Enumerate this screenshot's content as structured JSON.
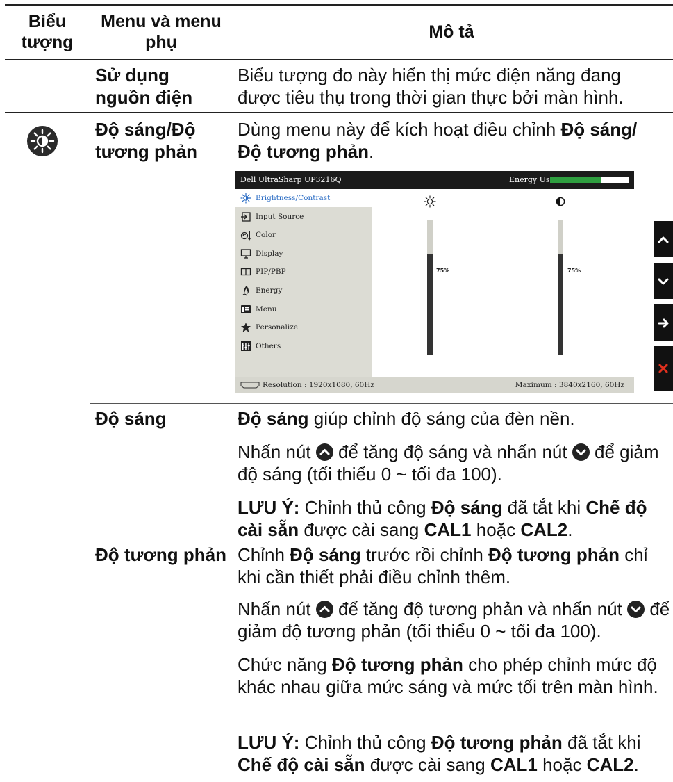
{
  "header": {
    "col_icon": "Biểu tượng",
    "col_menu": "Menu và menu phụ",
    "col_desc": "Mô tả"
  },
  "rows": {
    "power": {
      "name": "Sử dụng nguồn điện",
      "desc": "Biểu tượng đo này hiển thị mức điện năng đang được tiêu thụ trong thời gian thực bởi màn hình."
    },
    "brightness_contrast": {
      "icon": "brightness-icon",
      "name": "Độ sáng/Độ tương phản",
      "desc_prefix": "Dùng menu này để kích hoạt điều chỉnh ",
      "desc_bold": "Độ sáng/ Độ tương phản",
      "desc_suffix": "."
    },
    "brightness": {
      "name": "Độ sáng",
      "p1_bold": "Độ sáng",
      "p1_rest": " giúp chỉnh độ sáng của đèn nền.",
      "p2_a": "Nhấn nút ",
      "p2_b": " để tăng độ sáng và nhấn nút ",
      "p2_c": " để giảm độ sáng (tối thiểu 0 ~ tối đa 100).",
      "note_label": "LƯU Ý:",
      "note_a": " Chỉnh thủ công ",
      "note_b": "Độ sáng",
      "note_c": " đã tắt khi ",
      "note_d": "Chế độ cài sẵn",
      "note_e": " được cài sang ",
      "note_f": "CAL1",
      "note_g": " hoặc ",
      "note_h": "CAL2",
      "note_i": "."
    },
    "contrast": {
      "name": "Độ tương phản",
      "p1_a": "Chỉnh ",
      "p1_b": "Độ sáng",
      "p1_c": " trước rồi chỉnh ",
      "p1_d": "Độ tương phản",
      "p1_e": " chỉ khi cần thiết phải điều chỉnh thêm.",
      "p2_a": "Nhấn nút ",
      "p2_b": " để tăng độ tương phản và nhấn nút ",
      "p2_c": " để giảm độ tương phản (tối thiểu 0 ~ tối đa 100).",
      "p3_a": "Chức năng ",
      "p3_b": "Độ tương phản",
      "p3_c": " cho phép chỉnh mức độ khác nhau giữa mức sáng và mức tối trên màn hình.",
      "note_label": "LƯU Ý:",
      "note_a": " Chỉnh thủ công ",
      "note_b": "Độ tương phản",
      "note_c": " đã tắt khi ",
      "note_d": "Chế độ cài sẵn",
      "note_e": " được cài sang ",
      "note_f": "CAL1",
      "note_g": " hoặc ",
      "note_h": "CAL2",
      "note_i": "."
    }
  },
  "osd": {
    "title": "Dell UltraSharp UP3216Q",
    "energy_label": "Energy Use",
    "energy_level": 0.65,
    "energy_color": "#2e9e3f",
    "menu": [
      {
        "label": "Brightness/Contrast",
        "icon": "brightness-icon",
        "selected": true
      },
      {
        "label": "Input Source",
        "icon": "input-source-icon"
      },
      {
        "label": "Color",
        "icon": "color-icon"
      },
      {
        "label": "Display",
        "icon": "display-icon"
      },
      {
        "label": "PIP/PBP",
        "icon": "pip-pbp-icon"
      },
      {
        "label": "Energy",
        "icon": "energy-icon"
      },
      {
        "label": "Menu",
        "icon": "menu-icon"
      },
      {
        "label": "Personalize",
        "icon": "star-icon"
      },
      {
        "label": "Others",
        "icon": "others-icon"
      }
    ],
    "brightness_value": "75%",
    "brightness_level": 0.75,
    "contrast_value": "75%",
    "contrast_level": 0.75,
    "resolution": "Resolution : 1920x1080, 60Hz",
    "maximum": "Maximum : 3840x2160, 60Hz",
    "side_buttons": [
      "up-arrow-icon",
      "down-arrow-icon",
      "right-arrow-icon",
      "close-icon"
    ],
    "accent_color": "#2a6cc4",
    "close_color": "#e0301e"
  }
}
